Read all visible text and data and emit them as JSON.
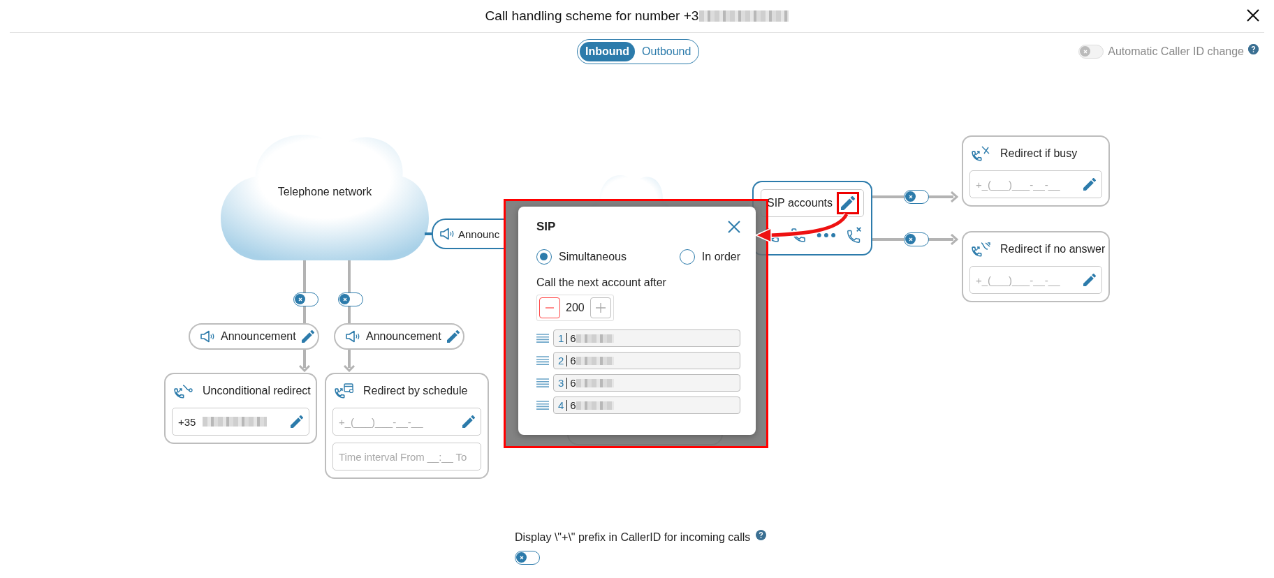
{
  "dialog_title": "Call handling scheme for number +3",
  "direction_tabs": [
    {
      "label": "Inbound",
      "selected": true
    },
    {
      "label": "Outbound",
      "selected": false
    }
  ],
  "auto_caller_id": {
    "label": "Automatic Caller ID change",
    "on": false,
    "disabled": true
  },
  "diagram": {
    "cloud_label": "Telephone network",
    "branches": [
      {
        "toggle_on": false,
        "announcement": "Announcement",
        "redirect": {
          "title": "Unconditional redirect",
          "kind": "number",
          "fields": [
            {
              "value": "+35"
            }
          ]
        }
      },
      {
        "toggle_on": false,
        "announcement": "Announcement",
        "redirect": {
          "title": "Redirect by schedule",
          "kind": "schedule",
          "fields": [
            {
              "placeholder": "+_(___)___-__-__"
            },
            {
              "placeholder": "Time interval From __:__ To"
            }
          ]
        }
      }
    ],
    "main_announcement": "Announc",
    "sip_node": {
      "label": "SIP accounts"
    },
    "sip_redirects": [
      {
        "title": "Redirect if busy",
        "kind": "busy",
        "toggle_on": false,
        "placeholder": "+_(___)___-__-__"
      },
      {
        "title": "Redirect if no answer",
        "kind": "noanswer",
        "toggle_on": false,
        "placeholder": "+_(___)___-__-__"
      }
    ]
  },
  "sip_dialog": {
    "title": "SIP",
    "modes": [
      {
        "label": "Simultaneous",
        "selected": true
      },
      {
        "label": "In order",
        "selected": false
      }
    ],
    "delay_label": "Call the next account after",
    "delay_value": "200",
    "accounts": [
      {
        "index": "1",
        "number": "6"
      },
      {
        "index": "2",
        "number": "6"
      },
      {
        "index": "3",
        "number": "6"
      },
      {
        "index": "4",
        "number": "6"
      }
    ]
  },
  "caller_id_prefix": {
    "label": "Display \\\"+\\\" prefix in CallerID for incoming calls",
    "on": false
  }
}
